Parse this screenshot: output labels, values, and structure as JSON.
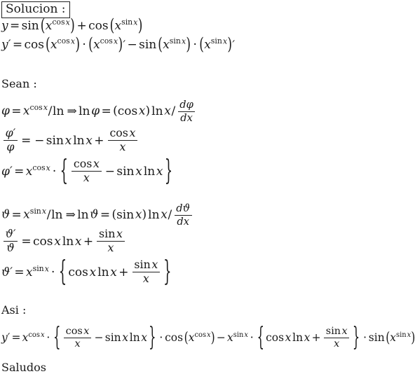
{
  "document": {
    "title_box": "Solucion :",
    "labels": {
      "sean": "Sean :",
      "asi": "Asi :",
      "saludos": "Saludos"
    },
    "tokens": {
      "y": "y",
      "y_prime": "y′",
      "phi": "φ",
      "phi_prime": "φ′",
      "vartheta": "ϑ",
      "vartheta_prime": "ϑ′",
      "x": "x",
      "sin": "sin",
      "cos": "cos",
      "ln": "ln",
      "d": "d",
      "equals": "=",
      "plus": "+",
      "minus": "−",
      "implies": "⇒",
      "cdot": "·",
      "slash": "/",
      "lparen": "(",
      "rparen": ")",
      "lbrace": "{",
      "rbrace": "}",
      "prime": "′"
    },
    "equations": {
      "eq_y": "y = sin (x^{cos x}) + cos (x^{sin x})",
      "eq_y_prime": "y′ = cos (x^{cos x}) · (x^{cos x})′ − sin (x^{sin x}) · (x^{sin x})′",
      "eq_phi_def": "φ = x^{cos x} / ln ⇒ ln φ = (cos x) ln x / dφ/dx",
      "eq_phi_log": "φ′/φ = − sin x ln x + cos x / x",
      "eq_phi_result": "φ′ = x^{cos x} · { cos x / x − sin x ln x }",
      "eq_theta_def": "ϑ = x^{sin x} / ln ⇒ ln ϑ = (sin x) ln x / dϑ/dx",
      "eq_theta_log": "ϑ′/ϑ = cos x ln x + sin x / x",
      "eq_theta_result": "ϑ′ = x^{sin x} · { cos x ln x + sin x / x }",
      "eq_final": "y′ = x^{cos x} · { cos x / x − sin x ln x } · cos (x^{cos x}) − x^{sin x} · { cos x ln x + sin x / x } · sin (x^{sin x})"
    }
  }
}
